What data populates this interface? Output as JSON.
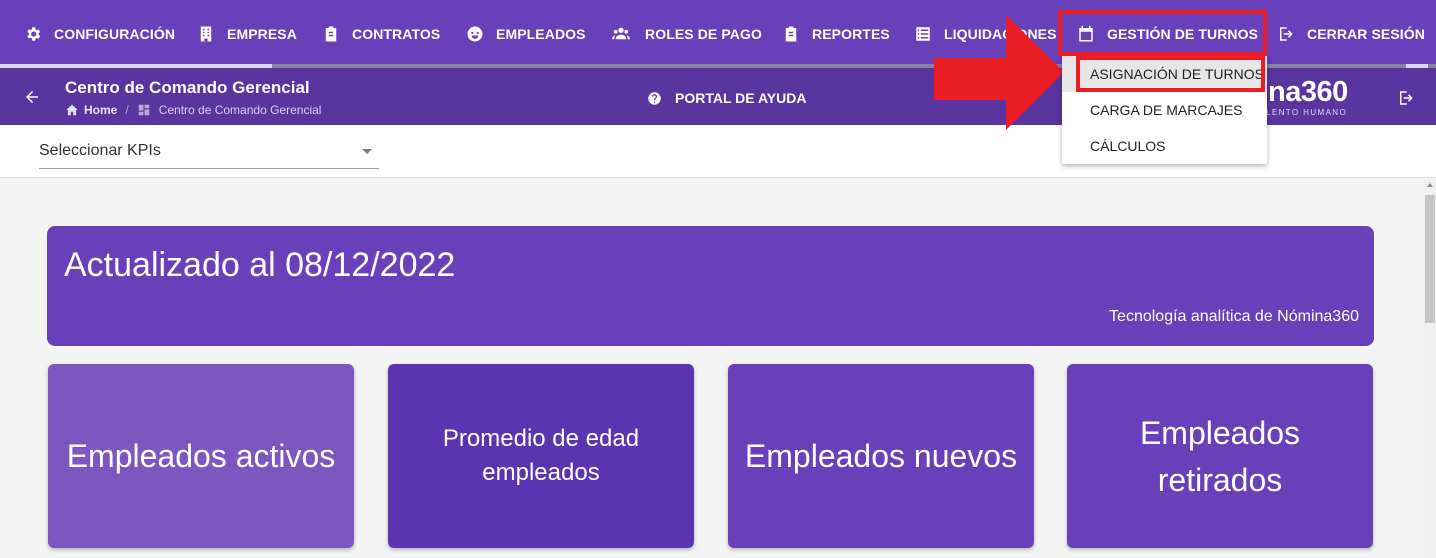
{
  "nav": {
    "items": [
      {
        "label": "CONFIGURACIÓN",
        "icon": "gear-icon"
      },
      {
        "label": "EMPRESA",
        "icon": "building-icon"
      },
      {
        "label": "CONTRATOS",
        "icon": "clipboard-icon"
      },
      {
        "label": "EMPLEADOS",
        "icon": "face-icon"
      },
      {
        "label": "ROLES DE PAGO",
        "icon": "people-icon"
      },
      {
        "label": "REPORTES",
        "icon": "clipboard-icon"
      },
      {
        "label": "LIQUIDACIONES",
        "icon": "list-icon"
      },
      {
        "label": "GESTIÓN DE TURNOS",
        "icon": "calendar-icon"
      },
      {
        "label": "CERRAR SESIÓN",
        "icon": "logout-icon"
      }
    ],
    "dropdown": [
      "ASIGNACIÓN DE TURNOS",
      "CARGA DE MARCAJES",
      "CÁLCULOS"
    ]
  },
  "header": {
    "title": "Centro de Comando Gerencial",
    "breadcrumb_home": "Home",
    "breadcrumb_current": "Centro de Comando Gerencial",
    "help_label": "PORTAL DE AYUDA",
    "brand": "na360",
    "brand_sub": "LENTO HUMANO"
  },
  "kpi": {
    "select_label": "Seleccionar KPIs"
  },
  "banner": {
    "title": "Actualizado al 08/12/2022",
    "subtitle": "Tecnología analítica de Nómina360"
  },
  "cards": [
    {
      "line1": "Empleados activos",
      "line2": ""
    },
    {
      "line1": "Promedio de edad",
      "line2": "empleados"
    },
    {
      "line1": "Empleados nuevos",
      "line2": ""
    },
    {
      "line1": "Empleados",
      "line2": "retirados"
    }
  ],
  "colors": {
    "primary": "#6a3fba",
    "highlight": "#ea1c24"
  }
}
